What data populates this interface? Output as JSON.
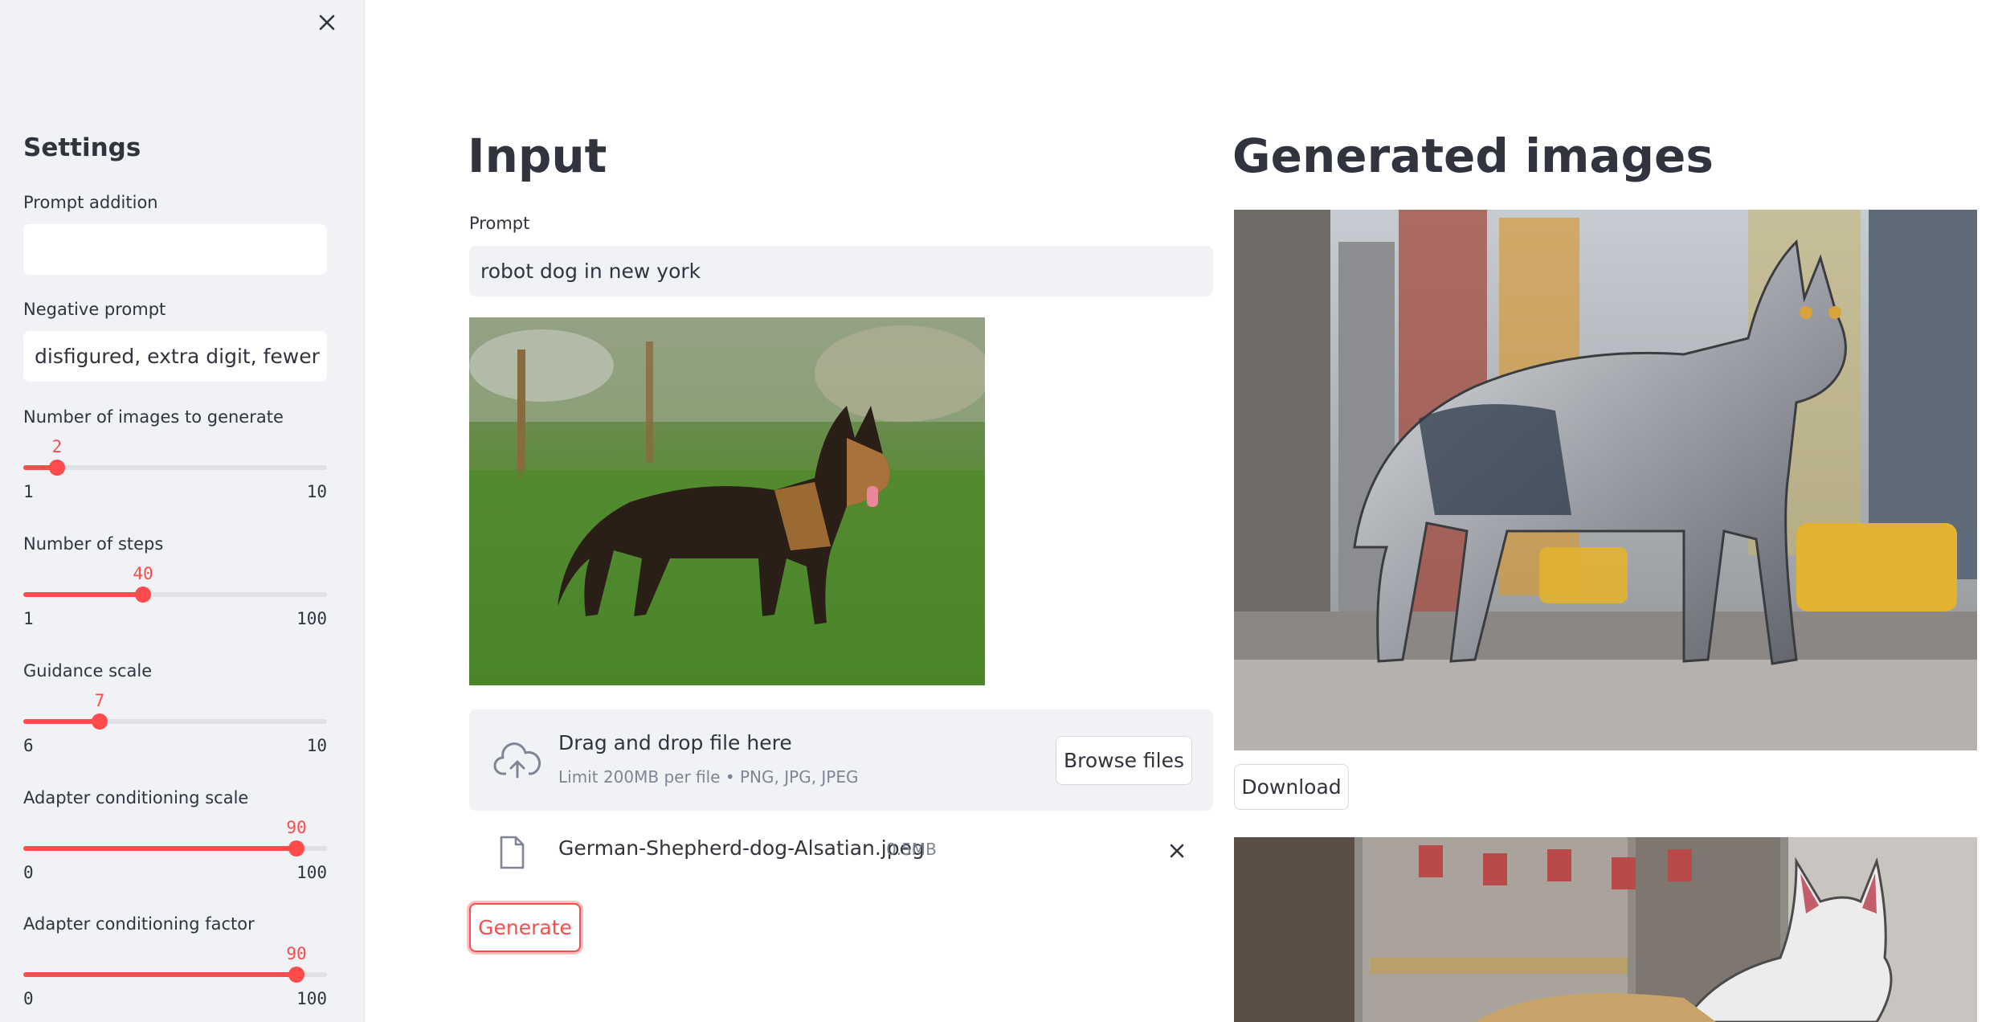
{
  "sidebar": {
    "title": "Settings",
    "prompt_addition": {
      "label": "Prompt addition",
      "value": ""
    },
    "negative_prompt": {
      "label": "Negative prompt",
      "value": "disfigured, extra digit, fewer digit"
    },
    "sliders": [
      {
        "label": "Number of images to generate",
        "value": "2",
        "min": "1",
        "max": "10",
        "fraction": 0.111
      },
      {
        "label": "Number of steps",
        "value": "40",
        "min": "1",
        "max": "100",
        "fraction": 0.394
      },
      {
        "label": "Guidance scale",
        "value": "7",
        "min": "6",
        "max": "10",
        "fraction": 0.25
      },
      {
        "label": "Adapter conditioning scale",
        "value": "90",
        "min": "0",
        "max": "100",
        "fraction": 0.9
      },
      {
        "label": "Adapter conditioning factor",
        "value": "90",
        "min": "0",
        "max": "100",
        "fraction": 0.9
      }
    ]
  },
  "input": {
    "heading": "Input",
    "prompt_label": "Prompt",
    "prompt_value": "robot dog in new york",
    "uploader": {
      "title": "Drag and drop file here",
      "limit": "Limit 200MB per file • PNG, JPG, JPEG",
      "browse_label": "Browse files"
    },
    "file": {
      "name": "German-Shepherd-dog-Alsatian.jpeg",
      "size": "0.5MB"
    },
    "generate_label": "Generate"
  },
  "output": {
    "heading": "Generated images",
    "download_label": "Download"
  },
  "colors": {
    "accent": "#ff4b4b",
    "sidebar_bg": "#f0f2f6",
    "text": "#31333f",
    "muted": "#808495"
  },
  "icons": [
    "close-icon",
    "cloud-upload-icon",
    "file-icon",
    "remove-file-icon"
  ]
}
